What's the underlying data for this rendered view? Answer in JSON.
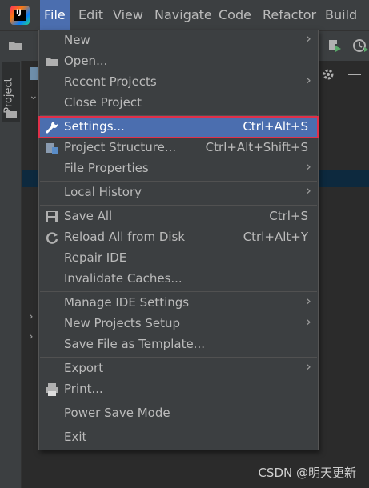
{
  "menubar": {
    "items": [
      "File",
      "Edit",
      "View",
      "Navigate",
      "Code",
      "Refactor",
      "Build"
    ]
  },
  "sidebar": {
    "project_tab": "Project"
  },
  "file_menu": {
    "items": [
      {
        "label": "New",
        "submenu": true
      },
      {
        "label": "Open...",
        "icon": "folder-icon"
      },
      {
        "label": "Recent Projects",
        "submenu": true
      },
      {
        "label": "Close Project"
      },
      {
        "label": "Settings...",
        "shortcut": "Ctrl+Alt+S",
        "icon": "wrench-icon",
        "selected": true
      },
      {
        "label": "Project Structure...",
        "shortcut": "Ctrl+Alt+Shift+S",
        "icon": "project-structure-icon"
      },
      {
        "label": "File Properties",
        "submenu": true
      },
      {
        "label": "Local History",
        "submenu": true
      },
      {
        "label": "Save All",
        "shortcut": "Ctrl+S",
        "icon": "save-icon"
      },
      {
        "label": "Reload All from Disk",
        "shortcut": "Ctrl+Alt+Y",
        "icon": "reload-icon"
      },
      {
        "label": "Repair IDE"
      },
      {
        "label": "Invalidate Caches..."
      },
      {
        "label": "Manage IDE Settings",
        "submenu": true
      },
      {
        "label": "New Projects Setup",
        "submenu": true
      },
      {
        "label": "Save File as Template..."
      },
      {
        "label": "Export",
        "submenu": true
      },
      {
        "label": "Print...",
        "icon": "printer-icon"
      },
      {
        "label": "Power Save Mode"
      },
      {
        "label": "Exit"
      }
    ]
  },
  "watermark": "CSDN @明天更新",
  "colors": {
    "menubar_bg": "#3c3f41",
    "selection": "#4b6eaf",
    "highlight_outline": "#e0304a",
    "editor_bg": "#2b2b2b"
  }
}
